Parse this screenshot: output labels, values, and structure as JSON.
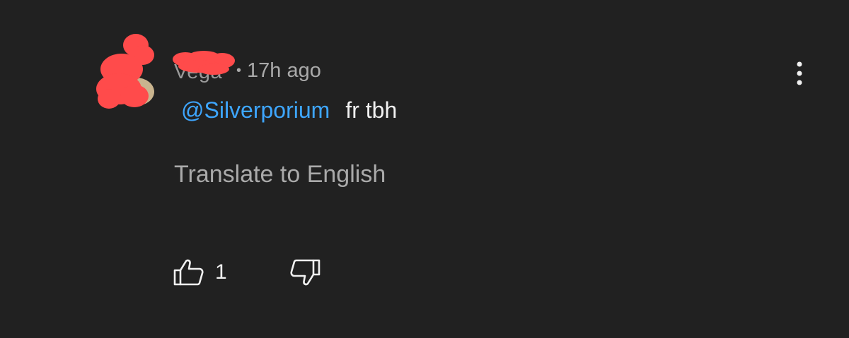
{
  "comment": {
    "author": "Vega",
    "separator": "•",
    "timestamp": "17h ago",
    "mention": "@Silverporium",
    "text": "fr tbh",
    "translate_label": "Translate to English",
    "like_count": "1"
  },
  "icons": {
    "menu": "more-vert-icon",
    "like": "thumbs-up-icon",
    "dislike": "thumbs-down-icon"
  },
  "colors": {
    "background": "#212121",
    "mention": "#3ea6ff",
    "redaction": "#ff4b4b",
    "primary_text": "#f1f1f1",
    "secondary_text": "#aaaaaa"
  }
}
